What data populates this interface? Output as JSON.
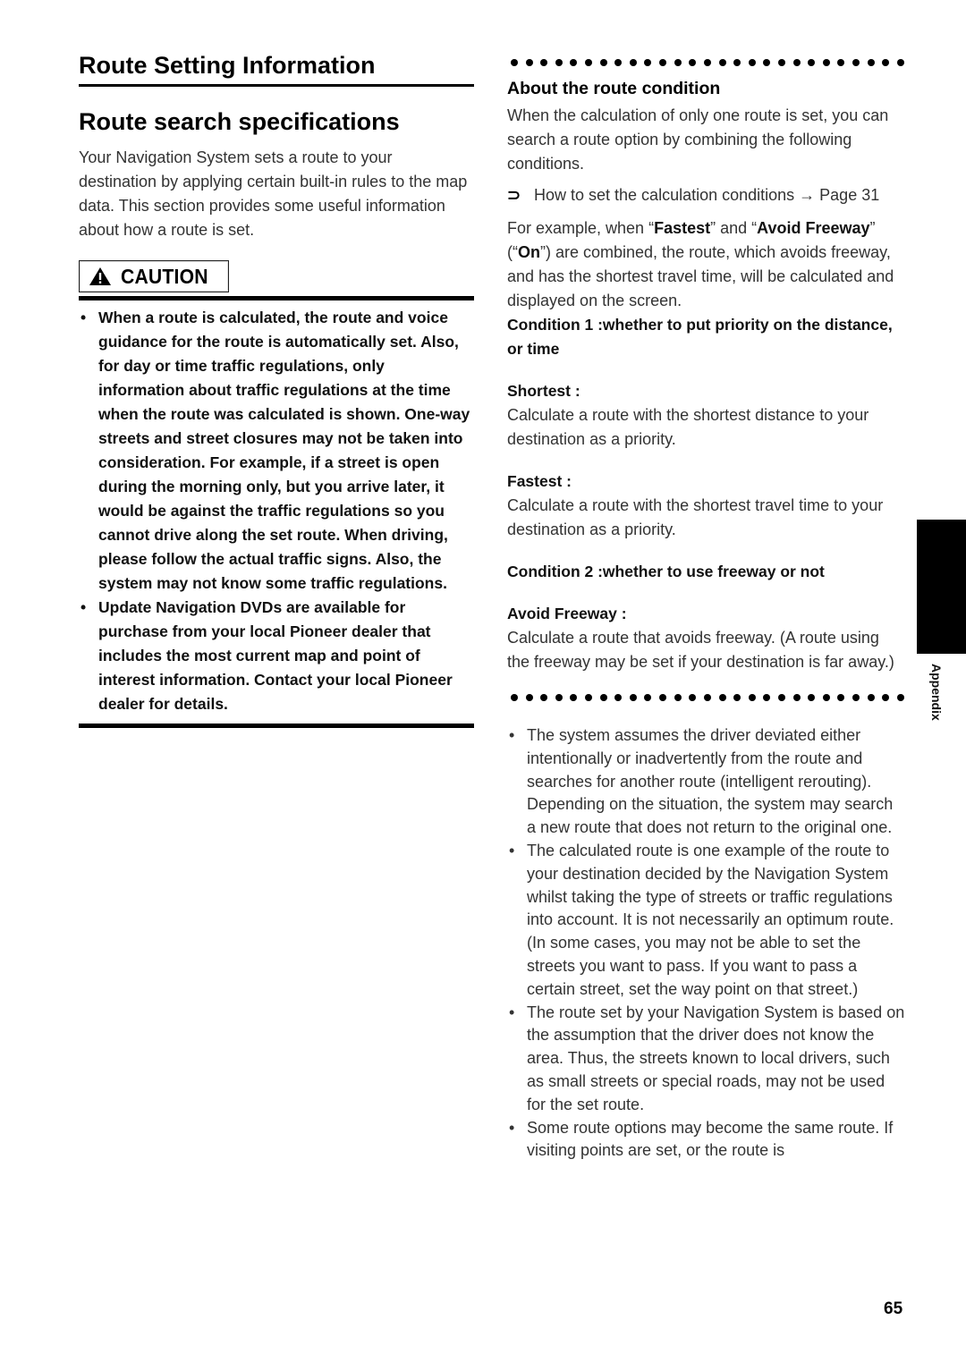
{
  "left": {
    "section_title": "Route Setting Information",
    "subsection_title": "Route search specifications",
    "intro": "Your Navigation System sets a route to your destination by applying certain built-in rules to the map data. This section provides some useful information about how a route is set.",
    "caution": {
      "icon": "warning-triangle-icon",
      "label": "CAUTION",
      "items": [
        "When a route is calculated, the route and voice guidance for the route is automatically set. Also, for day or time traffic regulations, only information about traffic regulations at the time when the route was calculated is shown. One-way streets and street closures may not be taken into consideration. For example, if a street is open during the morning only, but you arrive later, it would be against the traffic regulations so you cannot drive along the set route. When driving, please follow the actual traffic signs. Also, the system may not know some traffic regulations.",
        "Update Navigation DVDs are available for purchase from your local Pioneer dealer that includes the most current map and point of interest information. Contact your local Pioneer dealer for details."
      ]
    }
  },
  "right": {
    "box": {
      "heading": "About the route condition",
      "intro": "When the calculation of only one route is set, you can search a route option by combining the following conditions.",
      "reference": {
        "icon": "reference-arrow-icon",
        "text": "How to set the calculation conditions → Page 31"
      },
      "example": {
        "part1": "For example, when “",
        "bold1": "Fastest",
        "part2": "” and “",
        "bold2": "Avoid Freeway",
        "part3": "” (“",
        "bold3": "On",
        "part4": "”) are combined, the route, which avoids freeway, and has the shortest travel time, will be calculated and displayed on the screen."
      },
      "condition1": "Condition 1 :whether to put priority on the distance, or time",
      "shortest_label": "Shortest :",
      "shortest_desc": "Calculate a route with the shortest distance to your destination as a priority.",
      "fastest_label": "Fastest :",
      "fastest_desc": "Calculate a route with the shortest travel time to your destination as a priority.",
      "condition2": "Condition 2 :whether to use freeway or not",
      "avoid_label": "Avoid Freeway :",
      "avoid_desc": "Calculate a route that avoids freeway. (A route using the freeway may be set if your destination is far away.)"
    },
    "notes": [
      "The system assumes the driver deviated either intentionally or inadvertently from the route and searches for another route (intelligent rerouting). Depending on the situation, the system may search a new route that does not return to the original one.",
      "The calculated route is one example of the route to your destination decided by the Navigation System whilst taking the type of streets or traffic regulations into account. It is not necessarily an optimum route. (In some cases, you may not be able to set the streets you want to pass. If you want to pass a certain street, set the way point on that street.)",
      "The route set by your Navigation System is based on the assumption that the driver does not know the area. Thus, the streets known to local drivers, such as small streets or special roads, may not be used for the set route.",
      "Some route options may become the same route. If visiting points are set, or the route is"
    ]
  },
  "side_tab_label": "Appendix",
  "page_number": "65",
  "bullet_glyph": "•",
  "reference_glyph": "⊃"
}
